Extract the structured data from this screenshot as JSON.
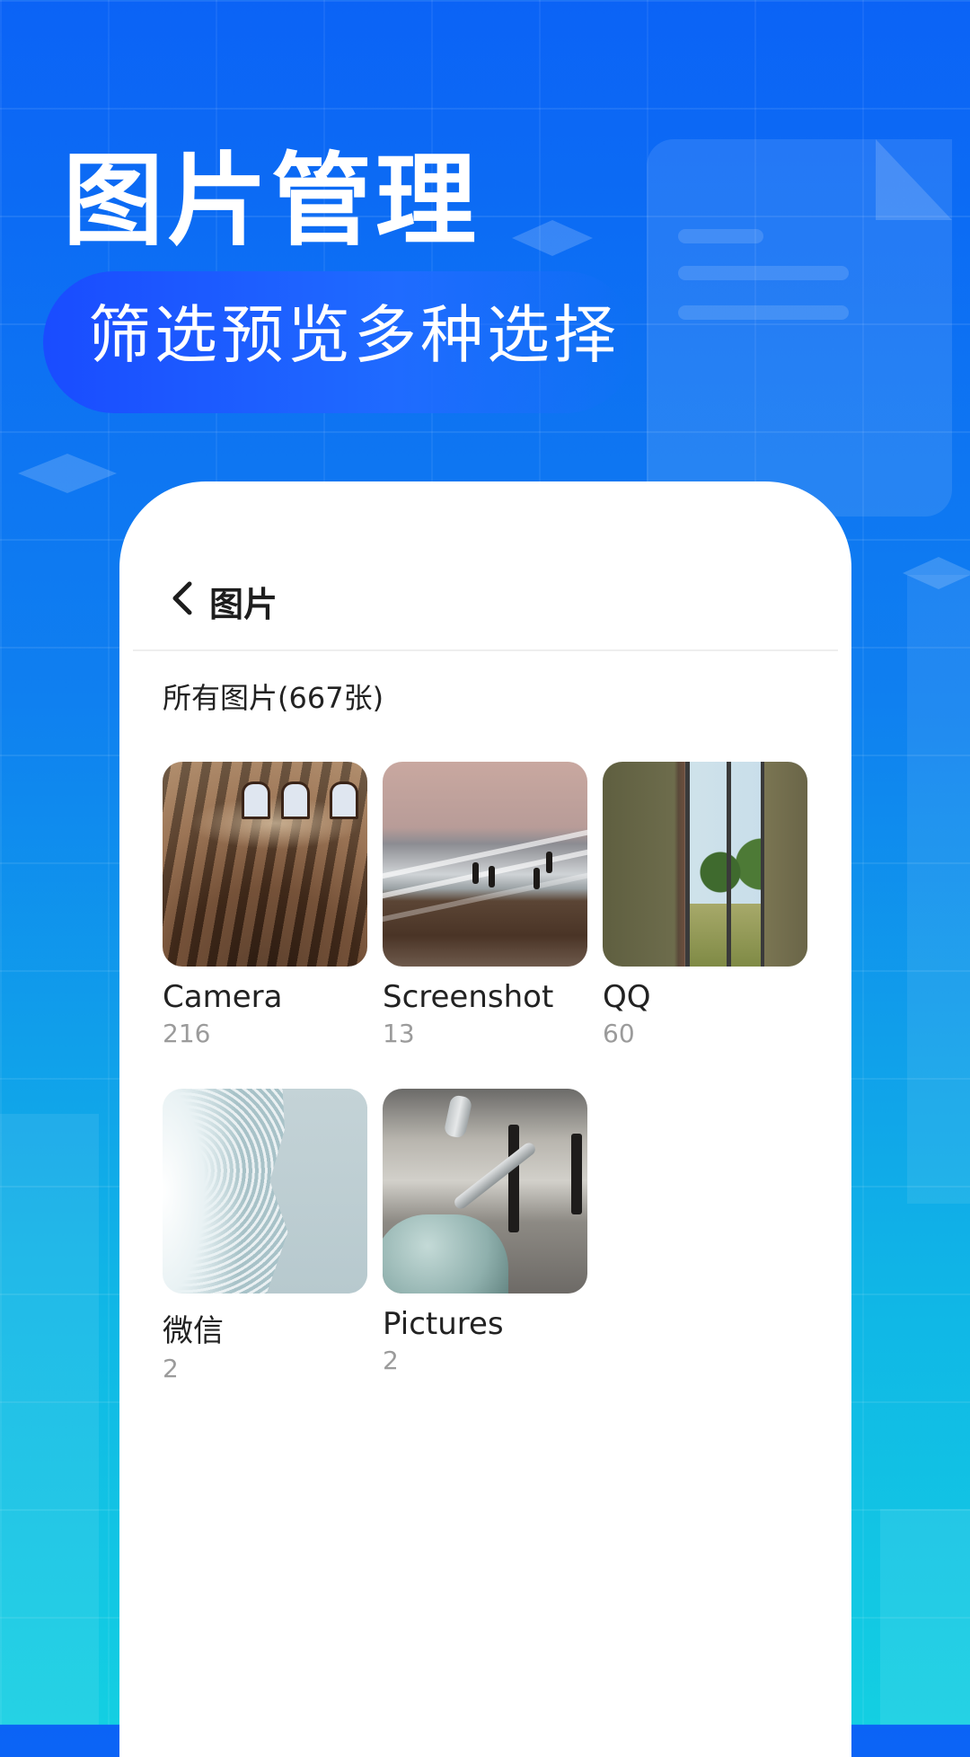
{
  "promo": {
    "title": "图片管理",
    "subtitle": "筛选预览多种选择"
  },
  "screen": {
    "nav_title": "图片",
    "section_title": "所有图片(667张)",
    "albums": [
      {
        "name": "Camera",
        "count": "216"
      },
      {
        "name": "Screenshot",
        "count": "13"
      },
      {
        "name": "QQ",
        "count": "60"
      },
      {
        "name": "微信",
        "count": "2"
      },
      {
        "name": "Pictures",
        "count": "2"
      }
    ]
  },
  "icons": {
    "back": "chevron-left-icon"
  },
  "colors": {
    "brand_blue": "#0b63f6",
    "brand_cyan": "#13cfe2",
    "text_primary": "#222222",
    "text_secondary": "#9b9b9b"
  }
}
